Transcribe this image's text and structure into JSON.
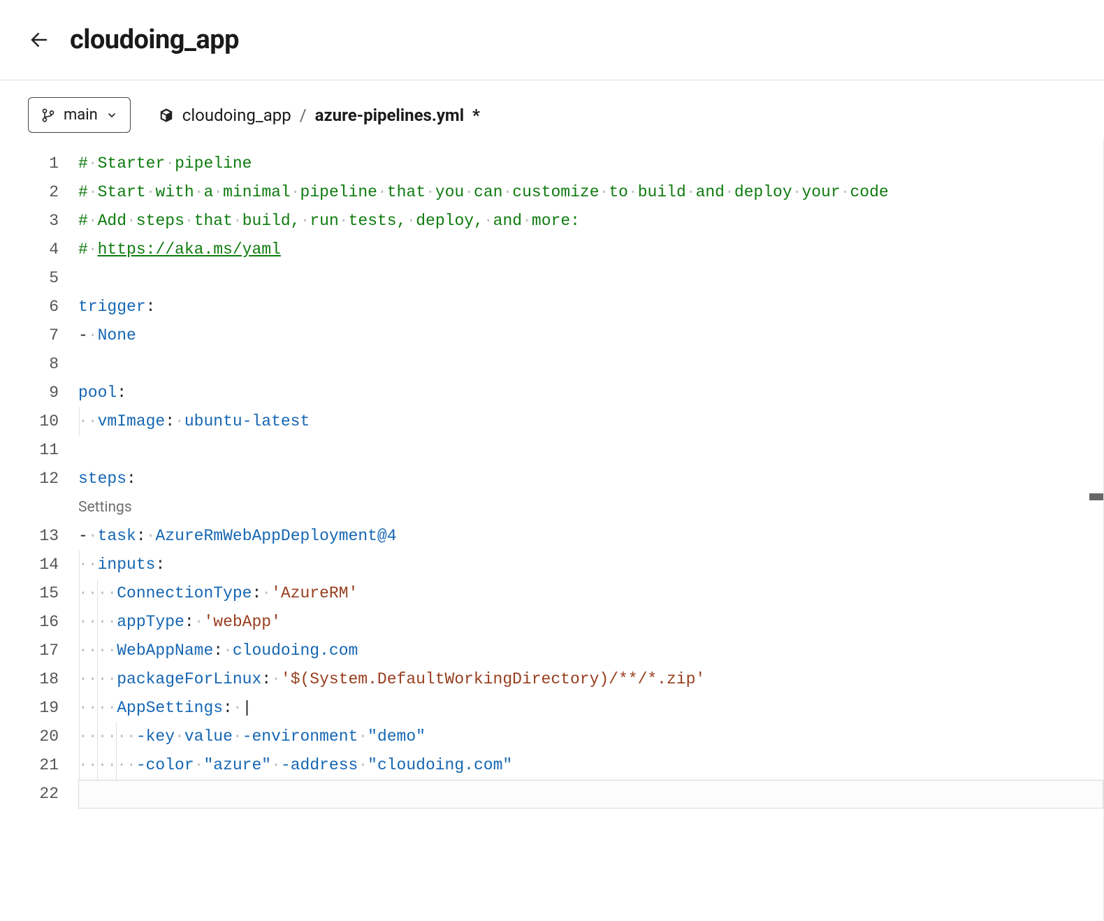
{
  "header": {
    "title": "cloudoing_app"
  },
  "branch": {
    "name": "main"
  },
  "breadcrumb": {
    "repo": "cloudoing_app",
    "file": "azure-pipelines.yml",
    "dirty_marker": "*"
  },
  "annotation": {
    "settings": "Settings"
  },
  "code": {
    "lines": [
      {
        "n": 1,
        "tokens": [
          {
            "t": "# ",
            "c": "comment"
          },
          {
            "t": "Starter ",
            "c": "comment"
          },
          {
            "t": "pipeline",
            "c": "comment"
          }
        ]
      },
      {
        "n": 2,
        "tokens": [
          {
            "t": "# ",
            "c": "comment"
          },
          {
            "t": "Start ",
            "c": "comment"
          },
          {
            "t": "with ",
            "c": "comment"
          },
          {
            "t": "a ",
            "c": "comment"
          },
          {
            "t": "minimal ",
            "c": "comment"
          },
          {
            "t": "pipeline ",
            "c": "comment"
          },
          {
            "t": "that ",
            "c": "comment"
          },
          {
            "t": "you ",
            "c": "comment"
          },
          {
            "t": "can ",
            "c": "comment"
          },
          {
            "t": "customize ",
            "c": "comment"
          },
          {
            "t": "to ",
            "c": "comment"
          },
          {
            "t": "build ",
            "c": "comment"
          },
          {
            "t": "and ",
            "c": "comment"
          },
          {
            "t": "deploy ",
            "c": "comment"
          },
          {
            "t": "your ",
            "c": "comment"
          },
          {
            "t": "code",
            "c": "comment"
          }
        ]
      },
      {
        "n": 3,
        "tokens": [
          {
            "t": "# ",
            "c": "comment"
          },
          {
            "t": "Add ",
            "c": "comment"
          },
          {
            "t": "steps ",
            "c": "comment"
          },
          {
            "t": "that ",
            "c": "comment"
          },
          {
            "t": "build, ",
            "c": "comment"
          },
          {
            "t": "run ",
            "c": "comment"
          },
          {
            "t": "tests, ",
            "c": "comment"
          },
          {
            "t": "deploy, ",
            "c": "comment"
          },
          {
            "t": "and ",
            "c": "comment"
          },
          {
            "t": "more:",
            "c": "comment"
          }
        ]
      },
      {
        "n": 4,
        "tokens": [
          {
            "t": "# ",
            "c": "comment"
          },
          {
            "t": "https://aka.ms/yaml",
            "c": "link"
          }
        ]
      },
      {
        "n": 5,
        "tokens": []
      },
      {
        "n": 6,
        "tokens": [
          {
            "t": "trigger",
            "c": "key"
          },
          {
            "t": ":",
            "c": "punct"
          }
        ]
      },
      {
        "n": 7,
        "tokens": [
          {
            "t": "- ",
            "c": "dash"
          },
          {
            "t": "None",
            "c": "scalar"
          }
        ]
      },
      {
        "n": 8,
        "tokens": []
      },
      {
        "n": 9,
        "tokens": [
          {
            "t": "pool",
            "c": "key"
          },
          {
            "t": ":",
            "c": "punct"
          }
        ]
      },
      {
        "n": 10,
        "indent": 2,
        "guides": [
          0
        ],
        "tokens": [
          {
            "t": "vmImage",
            "c": "key"
          },
          {
            "t": ": ",
            "c": "punct"
          },
          {
            "t": "ubuntu-latest",
            "c": "scalar"
          }
        ]
      },
      {
        "n": 11,
        "tokens": []
      },
      {
        "n": 12,
        "tokens": [
          {
            "t": "steps",
            "c": "key"
          },
          {
            "t": ":",
            "c": "punct"
          }
        ]
      },
      {
        "n": 13,
        "annotation_before": true,
        "tokens": [
          {
            "t": "- ",
            "c": "dash"
          },
          {
            "t": "task",
            "c": "key"
          },
          {
            "t": ": ",
            "c": "punct"
          },
          {
            "t": "AzureRmWebAppDeployment@4",
            "c": "scalar"
          }
        ]
      },
      {
        "n": 14,
        "indent": 2,
        "guides": [
          0
        ],
        "tokens": [
          {
            "t": "inputs",
            "c": "key"
          },
          {
            "t": ":",
            "c": "punct"
          }
        ]
      },
      {
        "n": 15,
        "indent": 4,
        "guides": [
          0,
          2
        ],
        "tokens": [
          {
            "t": "ConnectionType",
            "c": "key"
          },
          {
            "t": ": ",
            "c": "punct"
          },
          {
            "t": "'AzureRM'",
            "c": "string"
          }
        ]
      },
      {
        "n": 16,
        "indent": 4,
        "guides": [
          0,
          2
        ],
        "tokens": [
          {
            "t": "appType",
            "c": "key"
          },
          {
            "t": ": ",
            "c": "punct"
          },
          {
            "t": "'webApp'",
            "c": "string"
          }
        ]
      },
      {
        "n": 17,
        "indent": 4,
        "guides": [
          0,
          2
        ],
        "tokens": [
          {
            "t": "WebAppName",
            "c": "key"
          },
          {
            "t": ": ",
            "c": "punct"
          },
          {
            "t": "cloudoing.com",
            "c": "scalar"
          }
        ]
      },
      {
        "n": 18,
        "indent": 4,
        "guides": [
          0,
          2
        ],
        "tokens": [
          {
            "t": "packageForLinux",
            "c": "key"
          },
          {
            "t": ": ",
            "c": "punct"
          },
          {
            "t": "'$(System.DefaultWorkingDirectory)/**/*.zip'",
            "c": "string"
          }
        ]
      },
      {
        "n": 19,
        "indent": 4,
        "guides": [
          0,
          2
        ],
        "tokens": [
          {
            "t": "AppSettings",
            "c": "key"
          },
          {
            "t": ": ",
            "c": "punct"
          },
          {
            "t": "|",
            "c": "punct"
          }
        ]
      },
      {
        "n": 20,
        "indent": 6,
        "guides": [
          0,
          2,
          4
        ],
        "tokens": [
          {
            "t": "-key ",
            "c": "scalar"
          },
          {
            "t": "value ",
            "c": "scalar"
          },
          {
            "t": "-environment ",
            "c": "scalar"
          },
          {
            "t": "\"demo\"",
            "c": "scalar"
          }
        ]
      },
      {
        "n": 21,
        "indent": 6,
        "guides": [
          0,
          2,
          4
        ],
        "tokens": [
          {
            "t": "-color ",
            "c": "scalar"
          },
          {
            "t": "\"azure\" ",
            "c": "scalar"
          },
          {
            "t": "-address ",
            "c": "scalar"
          },
          {
            "t": "\"cloudoing.com\"",
            "c": "scalar"
          }
        ]
      },
      {
        "n": 22,
        "active": true,
        "tokens": []
      }
    ]
  }
}
